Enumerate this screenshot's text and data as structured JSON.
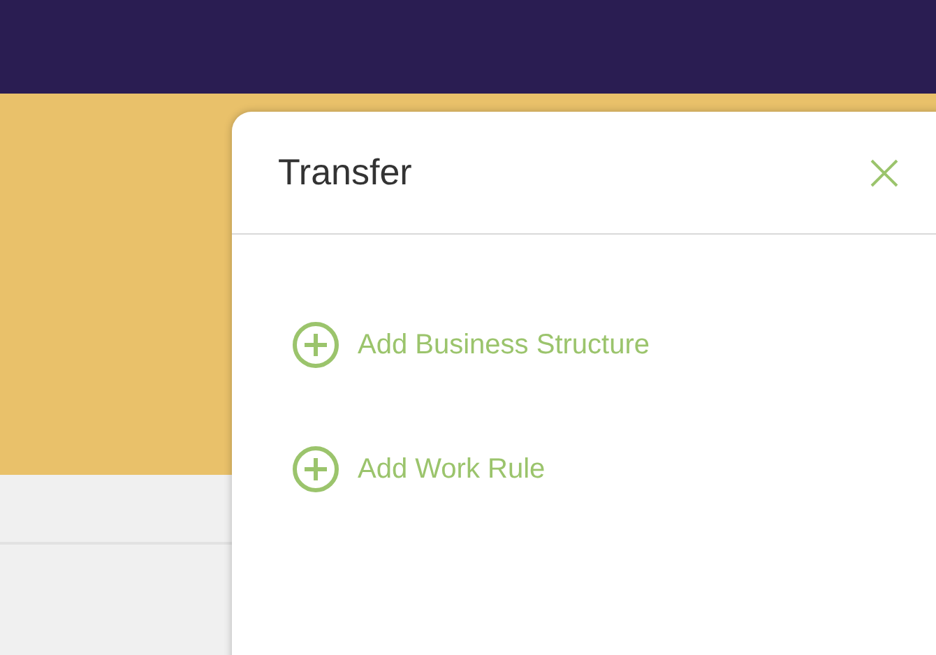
{
  "panel": {
    "title": "Transfer",
    "actions": [
      {
        "label": "Add Business Structure"
      },
      {
        "label": "Add Work Rule"
      }
    ]
  }
}
